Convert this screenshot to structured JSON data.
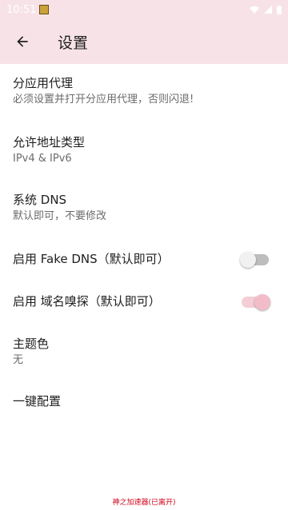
{
  "status_bar": {
    "time": "10:51"
  },
  "app_bar": {
    "title": "设置",
    "back_icon": "arrow-back-icon"
  },
  "settings": [
    {
      "title": "分应用代理",
      "subtitle": "必须设置并打开分应用代理，否则闪退!"
    },
    {
      "title": "允许地址类型",
      "subtitle": "IPv4 & IPv6"
    },
    {
      "title": "系统 DNS",
      "subtitle": "默认即可，不要修改"
    },
    {
      "title": "启用 Fake DNS（默认即可）",
      "toggle": false
    },
    {
      "title": "启用 域名嗅探（默认即可）",
      "toggle": true
    },
    {
      "title": "主题色",
      "subtitle": "无"
    },
    {
      "title": "一键配置"
    }
  ],
  "watermark": "神之加速器(已离开)",
  "colors": {
    "app_bar": "#f7e3e7",
    "accent": "#f2bcc9"
  }
}
